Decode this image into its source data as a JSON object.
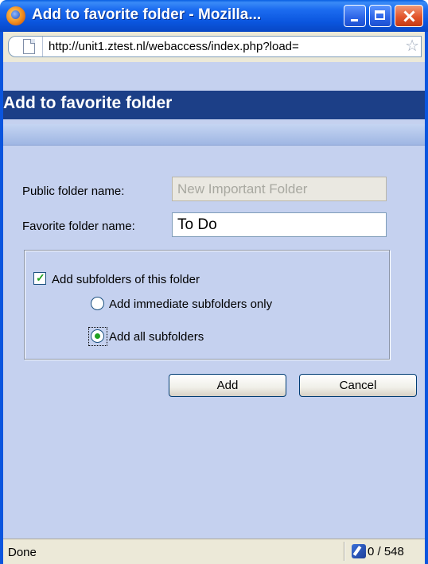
{
  "window": {
    "title": "Add to favorite folder - Mozilla...",
    "url": "http://unit1.ztest.nl/webaccess/index.php?load="
  },
  "page": {
    "header_title": "Add to favorite folder"
  },
  "form": {
    "public_folder_label": "Public folder name:",
    "public_folder_value": "New Important Folder",
    "favorite_folder_label": "Favorite folder name:",
    "favorite_folder_value": "To Do",
    "add_subfolders_label": "Add subfolders of this folder",
    "add_subfolders_checked": true,
    "radio_immediate_label": "Add immediate subfolders only",
    "radio_all_label": "Add all subfolders",
    "selected_radio": "all"
  },
  "buttons": {
    "add_label": "Add",
    "cancel_label": "Cancel"
  },
  "statusbar": {
    "status_text": "Done",
    "counter": "0 / 548"
  },
  "icons": [
    "firefox-icon",
    "page-icon",
    "bookmark-star-icon",
    "minimize-icon",
    "maximize-icon",
    "close-icon",
    "status-icon"
  ]
}
